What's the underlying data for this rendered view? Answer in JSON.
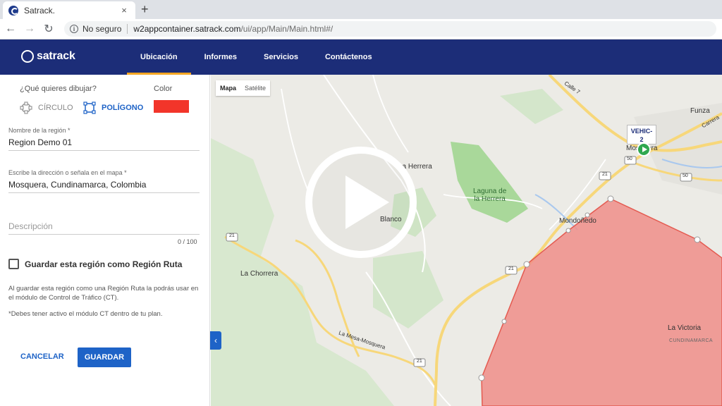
{
  "browser": {
    "tab_title": "Satrack.",
    "tab_close": "×",
    "new_tab": "+",
    "back": "←",
    "forward": "→",
    "reload": "↻",
    "info": "i",
    "security_text": "No seguro",
    "url_host": "w2appcontainer.satrack.com",
    "url_path": "/ui/app/Main/Main.html#/"
  },
  "app": {
    "logo": "satrack",
    "menu": [
      {
        "label": "Ubicación",
        "active": true
      },
      {
        "label": "Informes"
      },
      {
        "label": "Servicios"
      },
      {
        "label": "Contáctenos"
      }
    ]
  },
  "panel": {
    "draw_question": "¿Qué quieres dibujar?",
    "color_label": "Color",
    "circle_option": "CÍRCULO",
    "polygon_option": "POLÍGONO",
    "color_value": "#f2352a",
    "region_name_label": "Nombre de la región *",
    "region_name_value": "Region Demo 01",
    "address_label": "Escribe la dirección o señala en el mapa *",
    "address_value": "Mosquera, Cundinamarca, Colombia",
    "description_placeholder": "Descripción",
    "description_counter": "0 / 100",
    "route_checkbox_label": "Guardar esta región como Región Ruta",
    "help_text": "Al guardar esta región como una Región Ruta la podrás usar en el módulo de Control de Tráfico (CT).",
    "note_text": "*Debes tener activo el módulo CT dentro de tu plan.",
    "cancel_button": "CANCELAR",
    "save_button": "GUARDAR",
    "collapse_icon": "‹"
  },
  "map": {
    "type_map": "Mapa",
    "type_satellite": "Satélite",
    "vehicle_label_line1": "VEHIC-",
    "vehicle_label_line2": "2",
    "polygon_fill": "#f08e88",
    "labels": {
      "funza": "Funza",
      "mosquera": "Mosquera",
      "la_herrera": "La Herrera",
      "laguna_line1": "Laguna de",
      "laguna_line2": "la Herrera",
      "mondonedo": "Mondoñedo",
      "la_chorrera": "La Chorrera",
      "la_victoria": "La Victoria",
      "cundinamarca": "CUNDINAMARCA",
      "la_mesa_mosquera": "La Mesa-Mosquera",
      "calle_7": "Calle 7",
      "carrera": "Carrera",
      "blanco": "Blanco",
      "route_50a": "50",
      "route_50b": "50",
      "route_21a": "21",
      "route_21b": "21",
      "route_21c": "21",
      "route_21d": "21"
    }
  }
}
